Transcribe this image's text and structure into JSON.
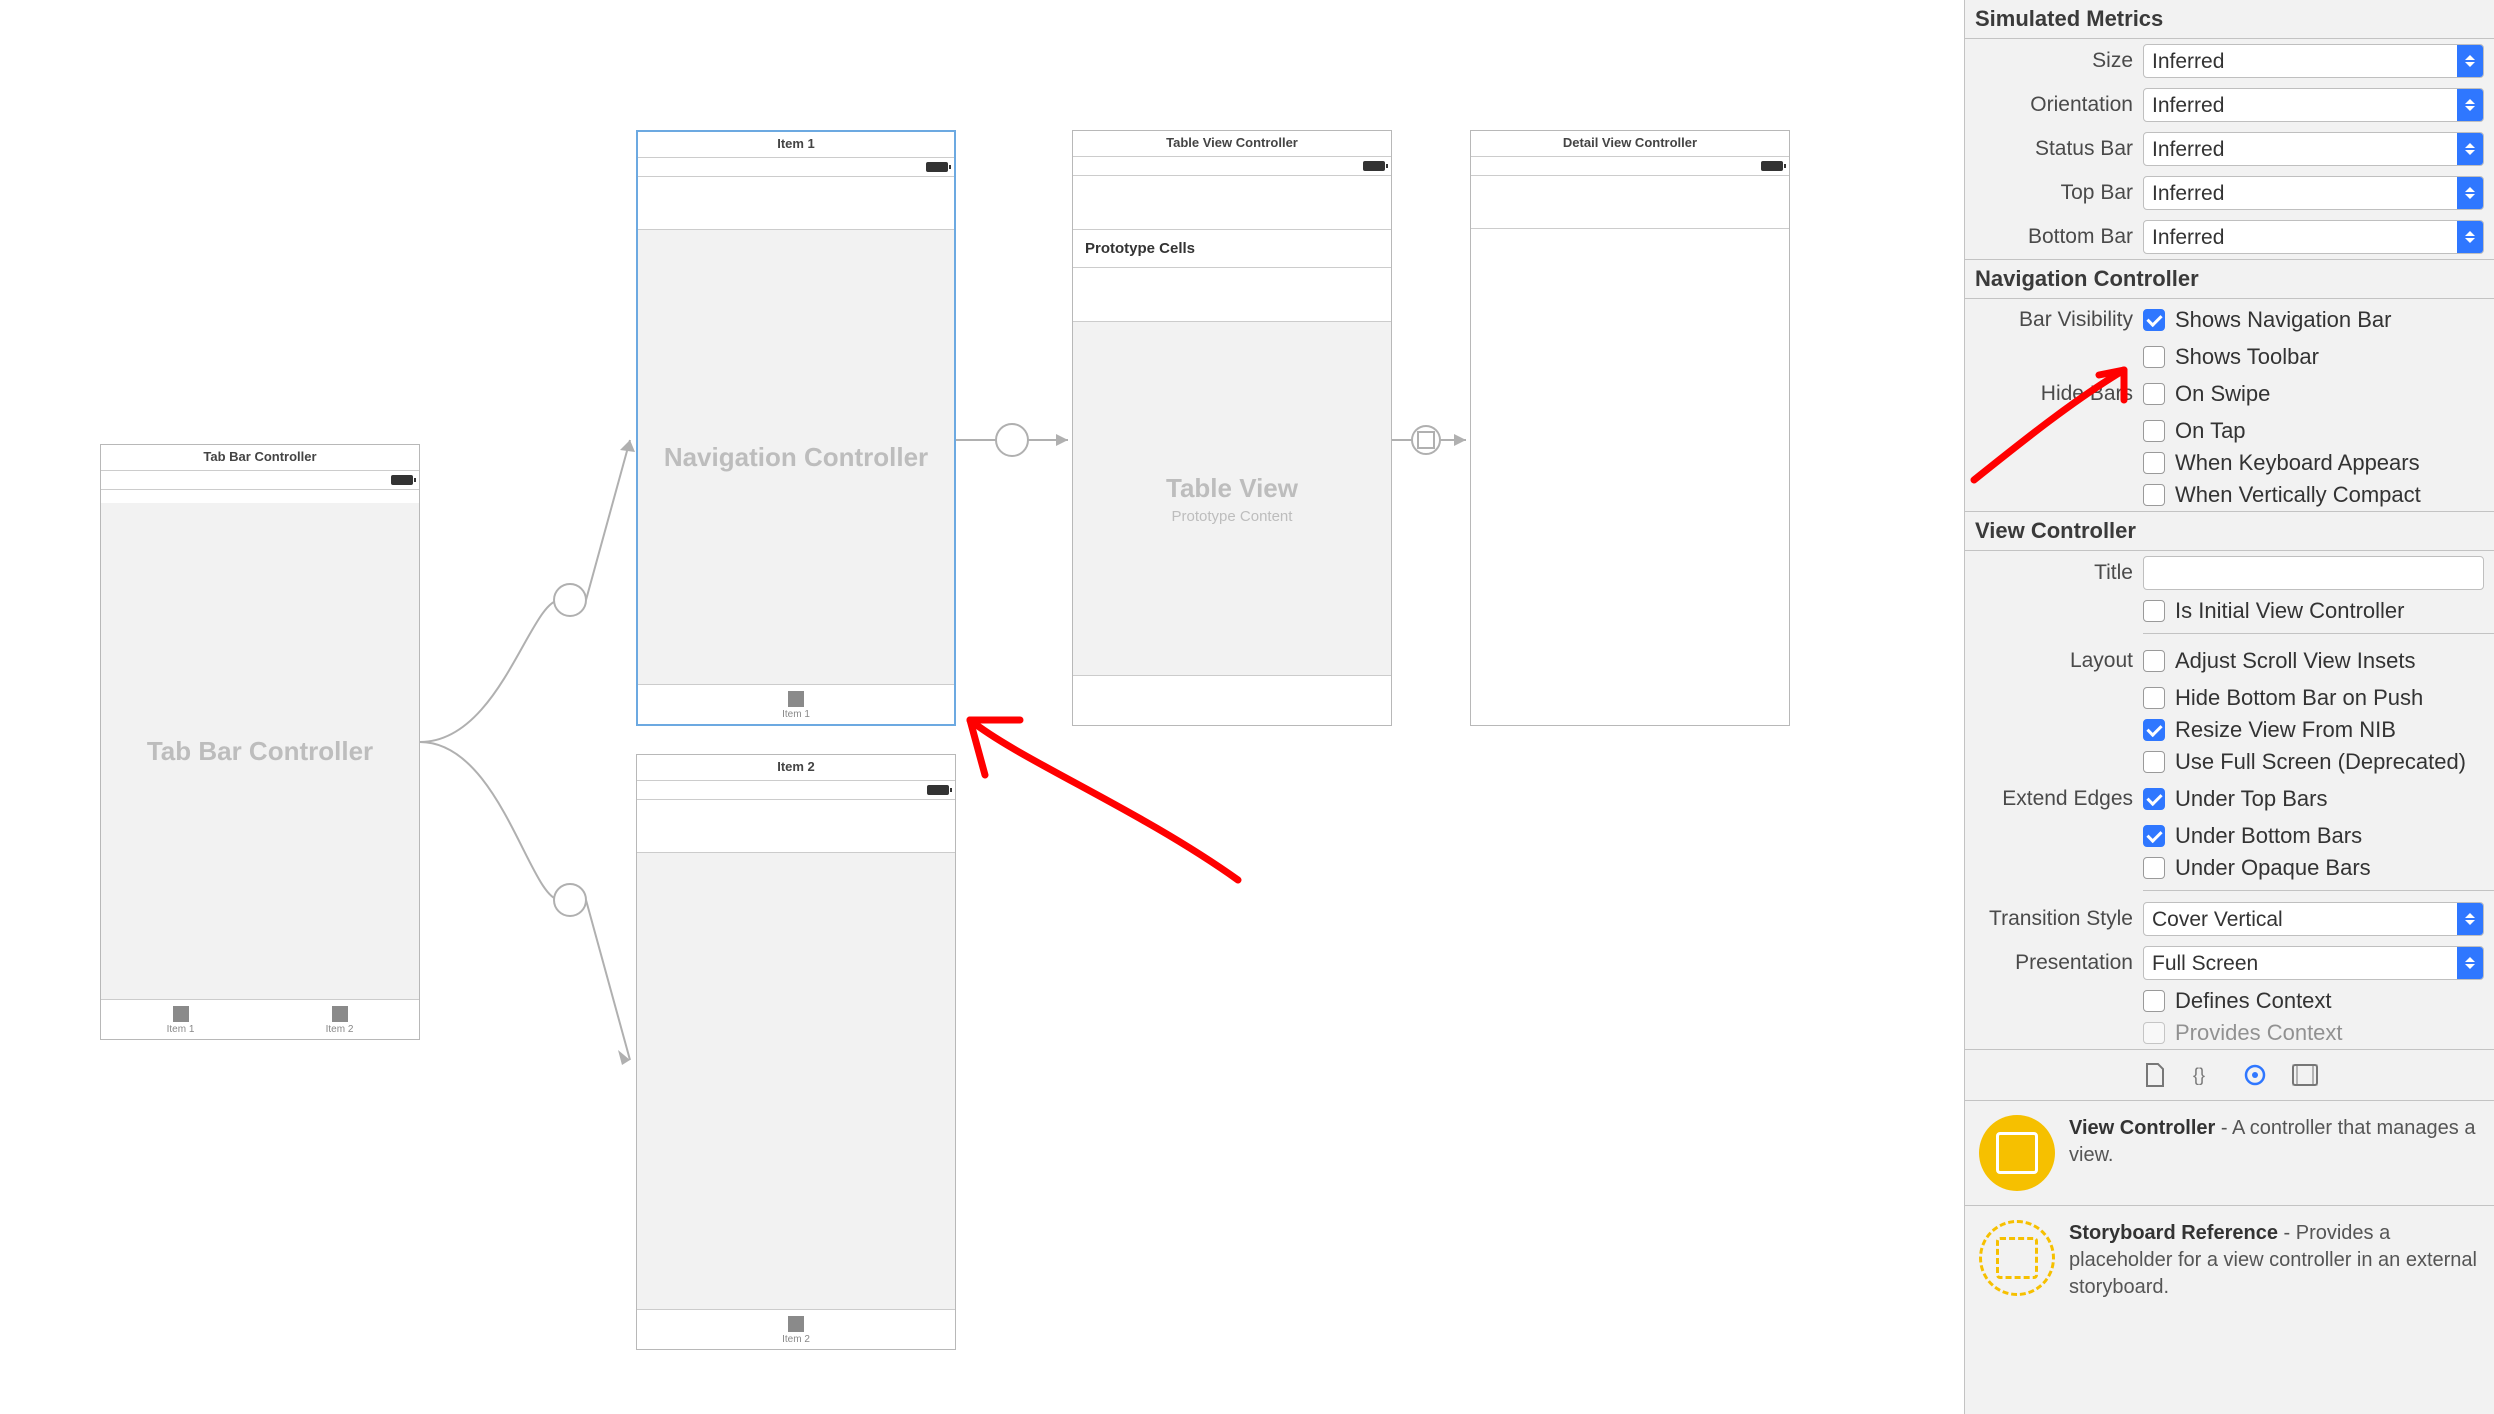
{
  "canvas": {
    "tab_bar_controller": {
      "title": "Tab Bar Controller",
      "placeholder": "Tab Bar Controller",
      "items": [
        {
          "label": "Item 1"
        },
        {
          "label": "Item 2"
        }
      ]
    },
    "nav_controller_1": {
      "title": "Item 1",
      "placeholder": "Navigation Controller",
      "tab_item_label": "Item 1"
    },
    "nav_controller_2": {
      "title": "Item 2",
      "tab_item_label": "Item 2"
    },
    "table_view_controller": {
      "title": "Table View Controller",
      "prototype_label": "Prototype Cells",
      "placeholder": "Table View",
      "placeholder_sub": "Prototype Content"
    },
    "detail_view_controller": {
      "title": "Detail View Controller"
    }
  },
  "inspector": {
    "simulated_metrics": {
      "header": "Simulated Metrics",
      "size": {
        "label": "Size",
        "value": "Inferred"
      },
      "orientation": {
        "label": "Orientation",
        "value": "Inferred"
      },
      "status_bar": {
        "label": "Status Bar",
        "value": "Inferred"
      },
      "top_bar": {
        "label": "Top Bar",
        "value": "Inferred"
      },
      "bottom_bar": {
        "label": "Bottom Bar",
        "value": "Inferred"
      }
    },
    "navigation_controller": {
      "header": "Navigation Controller",
      "bar_visibility_label": "Bar Visibility",
      "shows_nav_bar": {
        "label": "Shows Navigation Bar",
        "checked": true
      },
      "shows_toolbar": {
        "label": "Shows Toolbar",
        "checked": false
      },
      "hide_bars_label": "Hide Bars",
      "on_swipe": {
        "label": "On Swipe",
        "checked": false
      },
      "on_tap": {
        "label": "On Tap",
        "checked": false
      },
      "when_keyboard": {
        "label": "When Keyboard Appears",
        "checked": false
      },
      "when_compact": {
        "label": "When Vertically Compact",
        "checked": false
      }
    },
    "view_controller": {
      "header": "View Controller",
      "title_label": "Title",
      "title_value": "",
      "is_initial": {
        "label": "Is Initial View Controller",
        "checked": false
      },
      "layout_label": "Layout",
      "adjust_scroll": {
        "label": "Adjust Scroll View Insets",
        "checked": false
      },
      "hide_bottom": {
        "label": "Hide Bottom Bar on Push",
        "checked": false
      },
      "resize_nib": {
        "label": "Resize View From NIB",
        "checked": true
      },
      "full_screen_dep": {
        "label": "Use Full Screen (Deprecated)",
        "checked": false
      },
      "extend_edges_label": "Extend Edges",
      "under_top": {
        "label": "Under Top Bars",
        "checked": true
      },
      "under_bottom": {
        "label": "Under Bottom Bars",
        "checked": true
      },
      "under_opaque": {
        "label": "Under Opaque Bars",
        "checked": false
      },
      "transition_style": {
        "label": "Transition Style",
        "value": "Cover Vertical"
      },
      "presentation": {
        "label": "Presentation",
        "value": "Full Screen"
      },
      "defines_context": {
        "label": "Defines Context",
        "checked": false
      },
      "provides_context": {
        "label": "Provides Context",
        "checked": false
      }
    },
    "library": {
      "view_controller": {
        "title": "View Controller",
        "desc": " - A controller that manages a view."
      },
      "storyboard_ref": {
        "title": "Storyboard Reference",
        "desc": " - Provides a placeholder for a view controller in an external storyboard."
      }
    }
  }
}
